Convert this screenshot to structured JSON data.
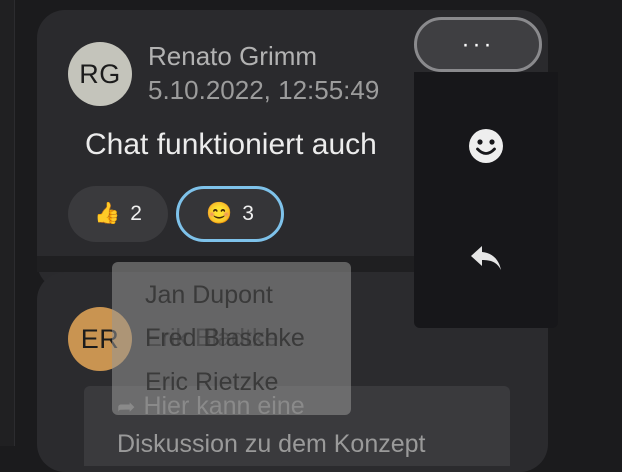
{
  "message": {
    "author_initials": "RG",
    "author": "Renato Grimm",
    "timestamp": "5.10.2022, 12:55:49",
    "text": "Chat funktioniert auch",
    "reactions": [
      {
        "emoji": "👍",
        "count": "2"
      },
      {
        "emoji": "😊",
        "count": "3"
      }
    ]
  },
  "more_button_label": "···",
  "reaction_tooltip": {
    "names": [
      "Jan Dupont",
      "Fred Blaschke",
      "Eric Rietzke"
    ],
    "ghost_text": "Erik Bladtke"
  },
  "next_message": {
    "author_initials": "ER",
    "quote_arrow": "➦",
    "quote_line1": "Hier kann eine",
    "quote_line2": "Diskussion zu dem Konzept"
  },
  "colors": {
    "highlight_border": "#7ec2ea",
    "avatar_rg": "#c4c4bb",
    "avatar_er": "#c99451"
  },
  "icons": {
    "menu_emoji": "smiley-face-icon",
    "menu_reply": "reply-arrow-icon"
  }
}
